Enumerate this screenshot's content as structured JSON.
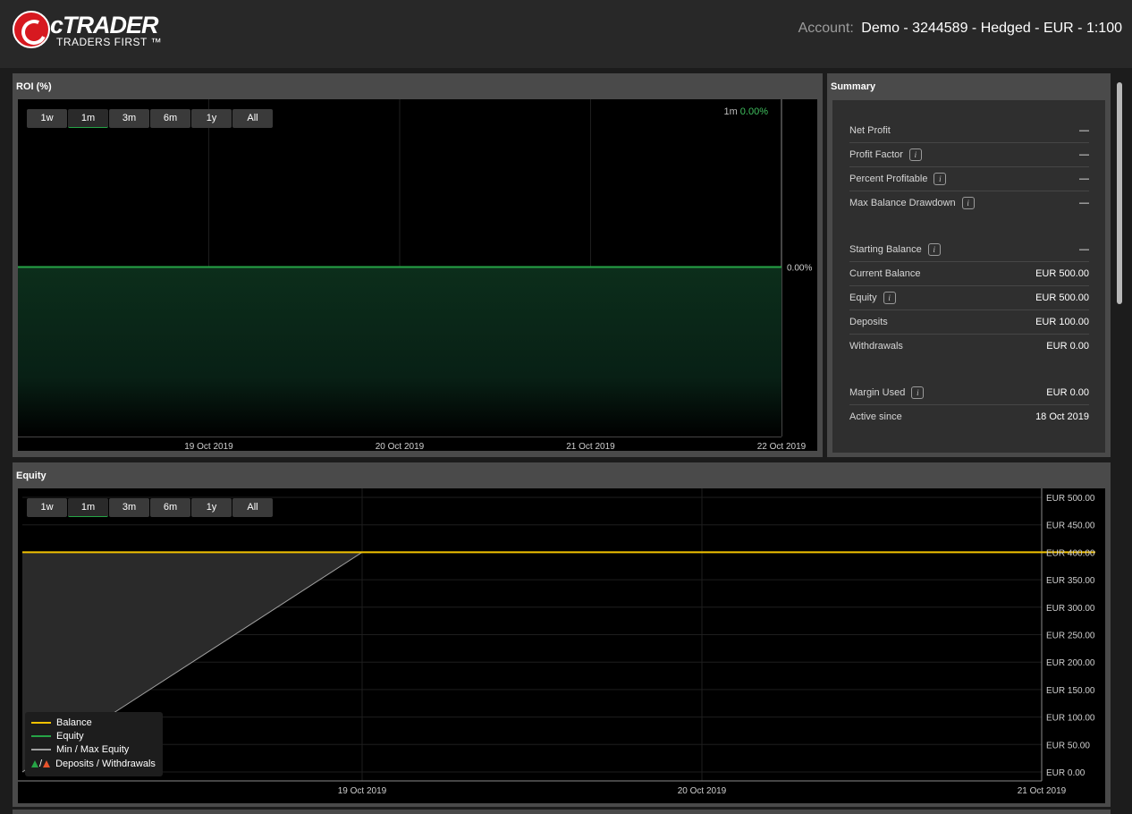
{
  "header": {
    "logo_text": "cTRADER",
    "logo_sub": "TRADERS FIRST ™",
    "account_label": "Account:",
    "account_value": "Demo - 3244589 - Hedged - EUR - 1:100"
  },
  "colors": {
    "header_bg": "#282828",
    "panel_bg": "#4a4a4a",
    "chart_bg": "#000000",
    "roi_line": "#26a446",
    "balance_line": "#f2c200",
    "equity_line": "#26a446",
    "minmax_line": "#a0a0a0",
    "deposit_marker": "#26a446",
    "withdrawal_marker": "#e8542c"
  },
  "range_buttons": [
    "1w",
    "1m",
    "3m",
    "6m",
    "1y",
    "All"
  ],
  "roi": {
    "title": "ROI (%)",
    "selected_range": "1m",
    "indicator_range": "1m",
    "indicator_value": "0.00%",
    "value_label": "0.00%"
  },
  "summary": {
    "title": "Summary",
    "rows": [
      {
        "label": "Net Profit",
        "value": "—",
        "info": false
      },
      {
        "label": "Profit Factor",
        "value": "—",
        "info": true
      },
      {
        "label": "Percent Profitable",
        "value": "—",
        "info": true
      },
      {
        "label": "Max Balance Drawdown",
        "value": "—",
        "info": true
      },
      {
        "label": "Starting Balance",
        "value": "—",
        "info": true
      },
      {
        "label": "Current Balance",
        "value": "EUR 500.00",
        "info": false
      },
      {
        "label": "Equity",
        "value": "EUR 500.00",
        "info": true
      },
      {
        "label": "Deposits",
        "value": "EUR 100.00",
        "info": false
      },
      {
        "label": "Withdrawals",
        "value": "EUR 0.00",
        "info": false
      },
      {
        "label": "Margin Used",
        "value": "EUR 0.00",
        "info": true
      },
      {
        "label": "Active since",
        "value": "18 Oct 2019",
        "info": false
      }
    ],
    "info_glyph": "i"
  },
  "equity": {
    "title": "Equity",
    "selected_range": "1m",
    "legend": {
      "balance": "Balance",
      "equity": "Equity",
      "minmax": "Min / Max Equity",
      "slash": "/",
      "deposits": "Deposits / Withdrawals"
    }
  },
  "chart_data": [
    {
      "type": "area",
      "title": "ROI (%)",
      "x": [
        "18 Oct 2019",
        "19 Oct 2019",
        "20 Oct 2019",
        "21 Oct 2019",
        "22 Oct 2019"
      ],
      "x_ticks": [
        "19 Oct 2019",
        "20 Oct 2019",
        "21 Oct 2019",
        "22 Oct 2019"
      ],
      "series": [
        {
          "values": [
            0,
            0,
            0,
            0,
            0
          ]
        }
      ],
      "y_tick_labels": [
        "0.00%"
      ],
      "ylim": [
        -100,
        100
      ],
      "grid": true
    },
    {
      "type": "line",
      "title": "Equity",
      "x_ticks": [
        "19 Oct 2019",
        "20 Oct 2019",
        "21 Oct 2019"
      ],
      "y_ticks": [
        0,
        50,
        100,
        150,
        200,
        250,
        300,
        350,
        400,
        450,
        500
      ],
      "y_tick_labels": [
        "EUR 0.00",
        "EUR 50.00",
        "EUR 100.00",
        "EUR 150.00",
        "EUR 200.00",
        "EUR 250.00",
        "EUR 300.00",
        "EUR 350.00",
        "EUR 400.00",
        "EUR 450.00",
        "EUR 500.00"
      ],
      "ylim": [
        0,
        500
      ],
      "xlim": [
        "18 Oct 2019",
        "21 Oct 2019"
      ],
      "series": [
        {
          "name": "Balance",
          "x": [
            "18 Oct 2019",
            "21 Oct 2019"
          ],
          "values": [
            400,
            400
          ]
        },
        {
          "name": "Min / Max Equity",
          "x": [
            "18 Oct 2019",
            "19 Oct 2019"
          ],
          "values": [
            0,
            400
          ]
        }
      ],
      "grid": true,
      "legend": "bottom-left"
    }
  ]
}
